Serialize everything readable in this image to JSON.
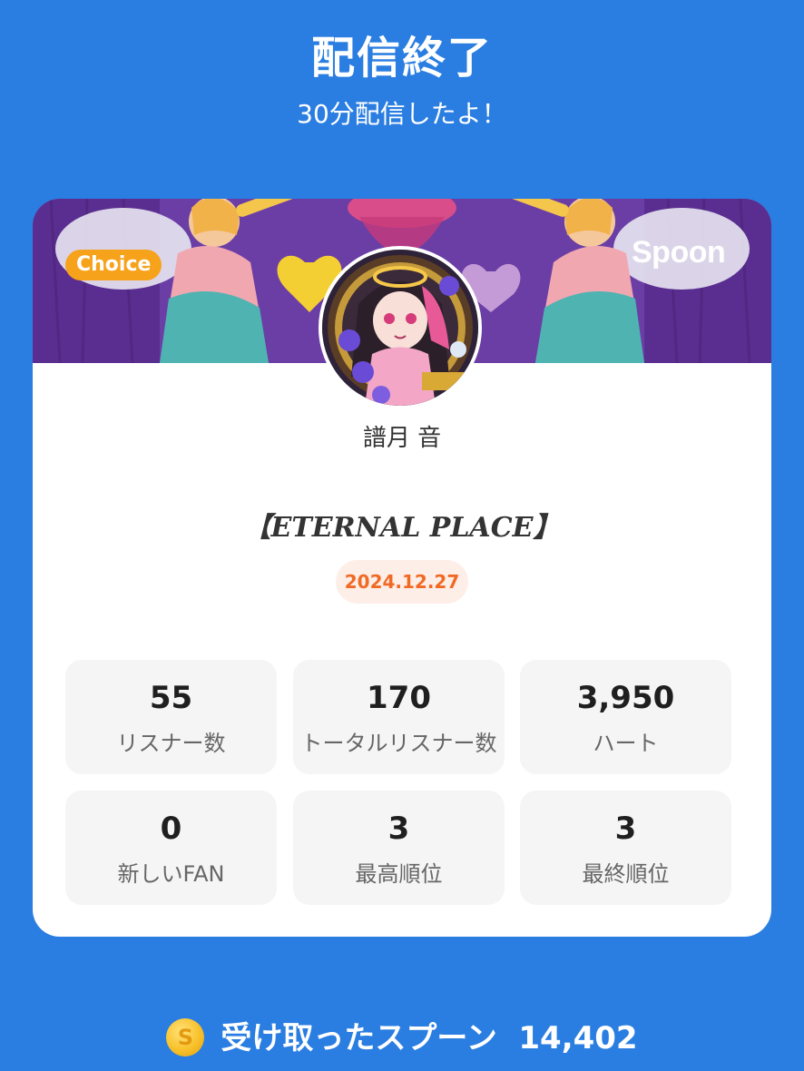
{
  "header": {
    "title": "配信終了",
    "subtitle": "30分配信したよ！"
  },
  "card": {
    "badge": "Choice",
    "brand": "Spoon",
    "username": "譜月 音",
    "stream_title": "【ETERNAL PLACE】",
    "date": "2024.12.27",
    "stats": [
      {
        "value": "55",
        "label": "リスナー数"
      },
      {
        "value": "170",
        "label": "トータルリスナー数"
      },
      {
        "value": "3,950",
        "label": "ハート"
      },
      {
        "value": "0",
        "label": "新しいFAN"
      },
      {
        "value": "3",
        "label": "最高順位"
      },
      {
        "value": "3",
        "label": "最終順位"
      }
    ]
  },
  "footer": {
    "coin_symbol": "S",
    "received_label": "受け取ったスプーン",
    "received_value": "14,402"
  },
  "colors": {
    "background": "#2a7de1",
    "badge": "#f7a21b",
    "date_text": "#f16a25",
    "date_bg": "#fdeee8"
  }
}
